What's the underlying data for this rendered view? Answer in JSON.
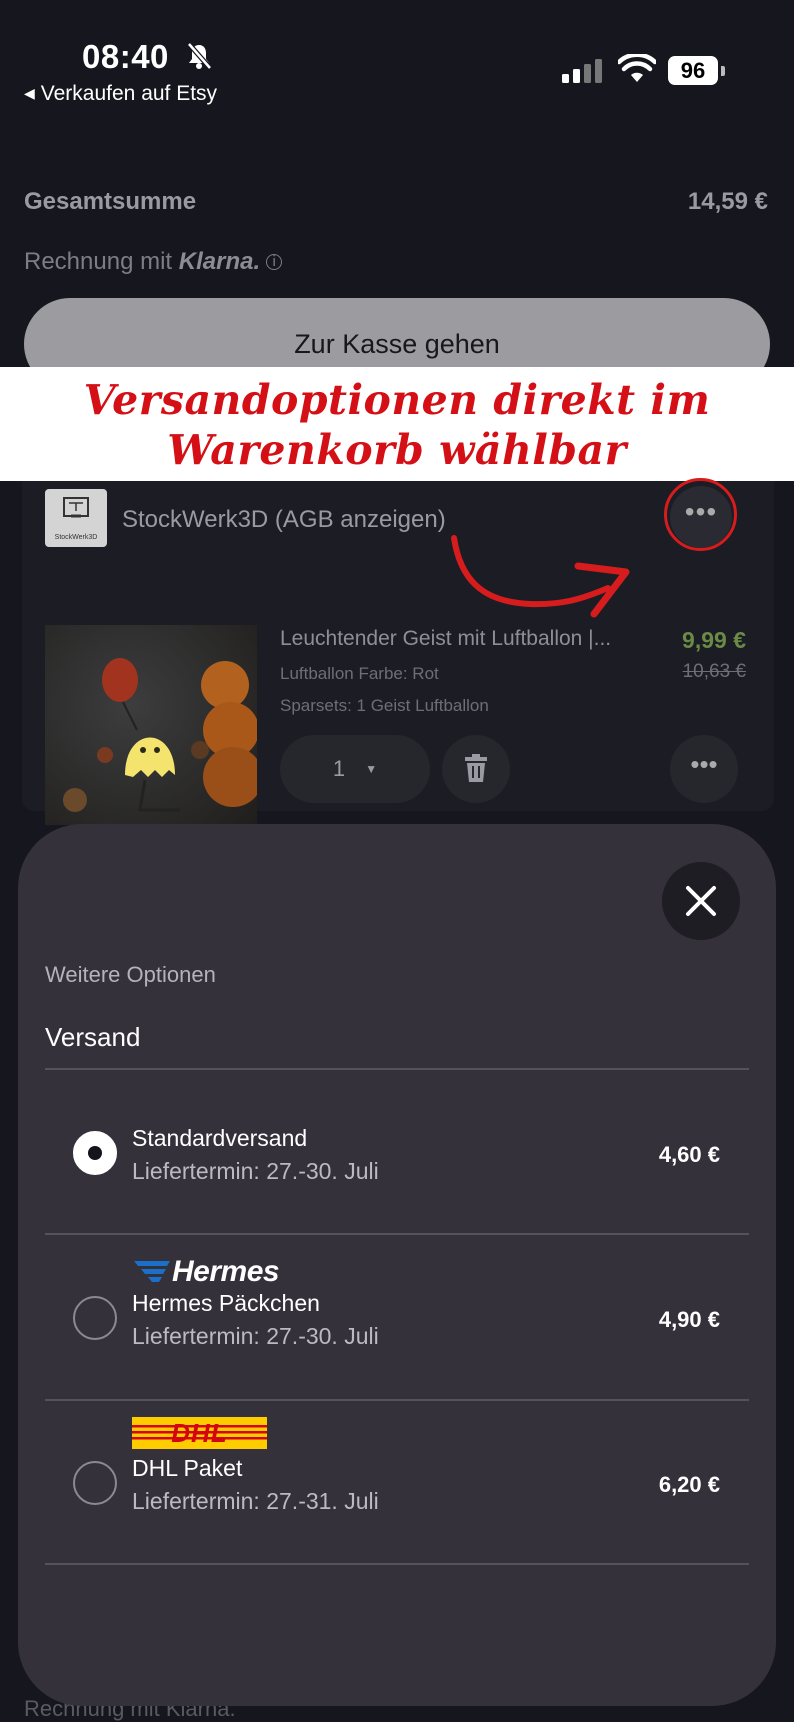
{
  "status_bar": {
    "time": "08:40",
    "back_app": "Verkaufen auf Etsy",
    "battery": "96"
  },
  "cart": {
    "total_label": "Gesamtsumme",
    "total_value": "14,59 €",
    "klarna_prefix": "Rechnung mit",
    "klarna_brand": "Klarna.",
    "checkout_label": "Zur Kasse gehen"
  },
  "banner": {
    "line1": "Versandoptionen direkt im",
    "line2": "Warenkorb wählbar"
  },
  "shop": {
    "logo_caption": "StockWerk3D",
    "name": "StockWerk3D  (AGB anzeigen)",
    "more_label": "•••"
  },
  "product": {
    "title": "Leuchtender Geist mit Luftballon |...",
    "price": "9,99 €",
    "old_price": "10,63 €",
    "variant1": "Luftballon Farbe: Rot",
    "variant2": "Sparsets: 1 Geist Luftballon",
    "quantity": "1",
    "more_label": "•••"
  },
  "sheet": {
    "subtitle": "Weitere Optionen",
    "title": "Versand",
    "options": [
      {
        "name": "Standardversand",
        "date": "Liefertermin: 27.-30. Juli",
        "price": "4,60 €",
        "selected": true
      },
      {
        "brand": "Hermes",
        "name": "Hermes Päckchen",
        "date": "Liefertermin: 27.-30. Juli",
        "price": "4,90 €",
        "selected": false
      },
      {
        "brand": "DHL",
        "name": "DHL Paket",
        "date": "Liefertermin: 27.-31. Juli",
        "price": "6,20 €",
        "selected": false
      }
    ]
  },
  "bottom": {
    "klarna_line": "Rechnung mit Klarna."
  },
  "colors": {
    "accent_red": "#d40f15",
    "sheet_bg": "#34313b",
    "page_bg": "#16161e",
    "sale_price": "#6b8a46",
    "dhl_yellow": "#ffcc00"
  }
}
